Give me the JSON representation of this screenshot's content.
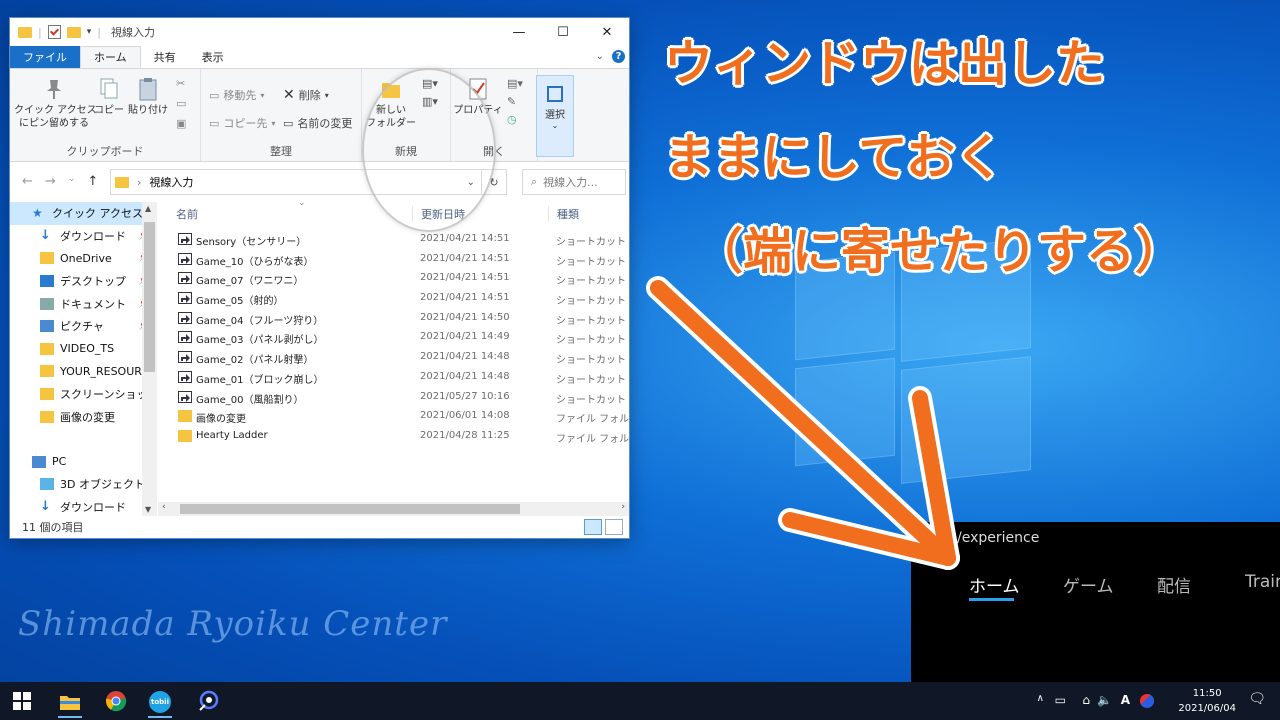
{
  "explorer": {
    "title": "視線入力",
    "tabs": {
      "file": "ファイル",
      "home": "ホーム",
      "share": "共有",
      "view": "表示"
    },
    "ribbon": {
      "quick_access_pin": "クイック アクセス\nにピン留めする",
      "copy": "コピー",
      "paste": "貼り付け",
      "group_clipboard": "クリップボード",
      "move_to": "移動先",
      "copy_to": "コピー先",
      "delete": "削除",
      "rename": "名前の変更",
      "group_organize": "整理",
      "new_folder": "新しい\nフォルダー",
      "group_new": "新規",
      "properties": "プロパティ",
      "group_open": "開く",
      "select": "選択"
    },
    "address": {
      "path": "視線入力",
      "search_placeholder": "視線入力..."
    },
    "nav": [
      {
        "label": "クイック アクセス",
        "icon": "star-icon",
        "selected": true
      },
      {
        "label": "ダウンロード",
        "icon": "download-icon",
        "pinned": true
      },
      {
        "label": "OneDrive",
        "icon": "folder-icon",
        "pinned": true
      },
      {
        "label": "デスクトップ",
        "icon": "desktop-icon",
        "pinned": true
      },
      {
        "label": "ドキュメント",
        "icon": "document-icon",
        "pinned": true
      },
      {
        "label": "ピクチャ",
        "icon": "picture-icon",
        "pinned": true
      },
      {
        "label": "VIDEO_TS",
        "icon": "folder-icon"
      },
      {
        "label": "YOUR_RESOURC",
        "icon": "folder-icon"
      },
      {
        "label": "スクリーンショット",
        "icon": "folder-icon"
      },
      {
        "label": "画像の変更",
        "icon": "folder-icon"
      },
      {
        "label": "",
        "icon": ""
      },
      {
        "label": "PC",
        "icon": "pc-icon"
      },
      {
        "label": "3D オブジェクト",
        "icon": "cube-icon"
      },
      {
        "label": "ダウンロード",
        "icon": "download-icon"
      }
    ],
    "columns": {
      "name": "名前",
      "date": "更新日時",
      "type": "種類"
    },
    "files": [
      {
        "name": "Sensory（センサリー）",
        "date": "2021/04/21 14:51",
        "type": "ショートカット",
        "kind": "shortcut"
      },
      {
        "name": "Game_10（ひらがな表）",
        "date": "2021/04/21 14:51",
        "type": "ショートカット",
        "kind": "shortcut"
      },
      {
        "name": "Game_07（ワニワニ）",
        "date": "2021/04/21 14:51",
        "type": "ショートカット",
        "kind": "shortcut"
      },
      {
        "name": "Game_05（射的）",
        "date": "2021/04/21 14:51",
        "type": "ショートカット",
        "kind": "shortcut"
      },
      {
        "name": "Game_04（フルーツ狩り）",
        "date": "2021/04/21 14:50",
        "type": "ショートカット",
        "kind": "shortcut"
      },
      {
        "name": "Game_03（パネル剥がし）",
        "date": "2021/04/21 14:49",
        "type": "ショートカット",
        "kind": "shortcut"
      },
      {
        "name": "Game_02（パネル射撃）",
        "date": "2021/04/21 14:48",
        "type": "ショートカット",
        "kind": "shortcut"
      },
      {
        "name": "Game_01（ブロック崩し）",
        "date": "2021/04/21 14:48",
        "type": "ショートカット",
        "kind": "shortcut"
      },
      {
        "name": "Game_00（風船割り）",
        "date": "2021/05/27 10:16",
        "type": "ショートカット",
        "kind": "shortcut"
      },
      {
        "name": "画像の変更",
        "date": "2021/06/01 14:08",
        "type": "ファイル フォルダー",
        "kind": "folder"
      },
      {
        "name": "Hearty Ladder",
        "date": "2021/04/28 11:25",
        "type": "ファイル フォルダー",
        "kind": "folder"
      }
    ],
    "status": "11 個の項目"
  },
  "app": {
    "title": "/experience",
    "nav": [
      "ホーム",
      "ゲーム",
      "配信",
      "Trair"
    ]
  },
  "annotation": {
    "line1": "ウィンドウは出した",
    "line2": "ままにしておく",
    "line3": "（端に寄せたりする）",
    "color": "#f06e1e"
  },
  "watermark": "Shimada Ryoiku Center",
  "taskbar": {
    "apps": [
      "start-icon",
      "file-explorer-icon",
      "chrome-icon",
      "tobii-icon",
      "eye-app-icon"
    ],
    "tobii_label": "tobii",
    "ime": "A",
    "time": "11:50",
    "date": "2021/06/04"
  }
}
